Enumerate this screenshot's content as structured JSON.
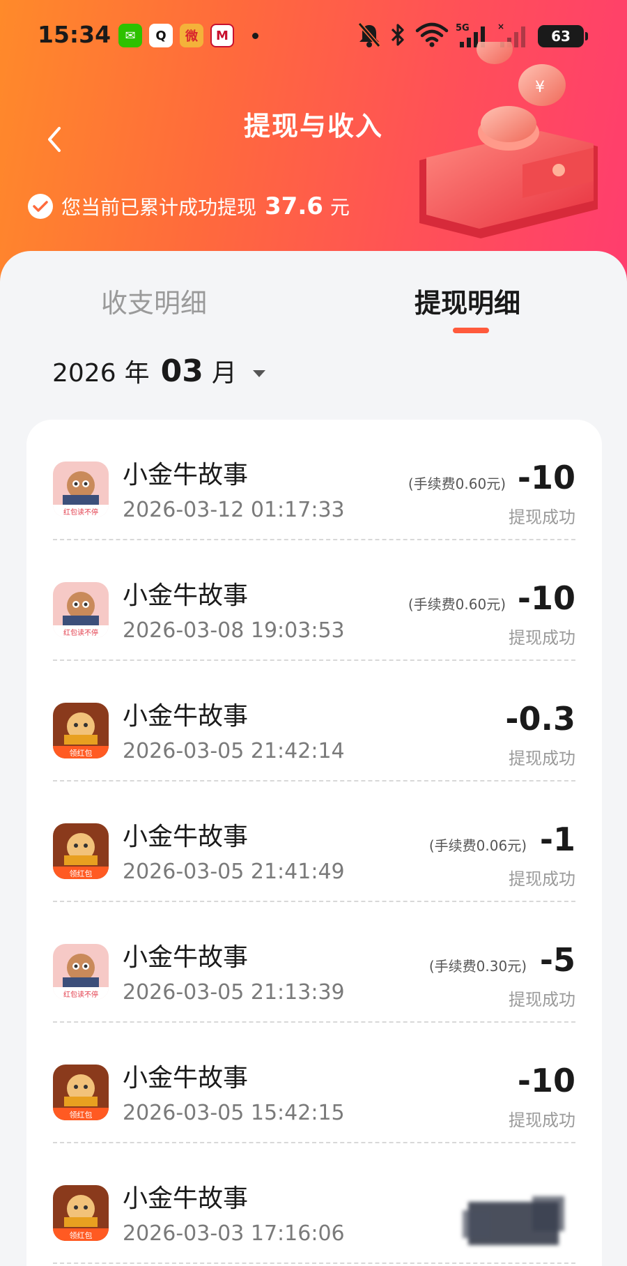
{
  "status_bar": {
    "time": "15:34",
    "battery": "63",
    "icons": [
      "wechat-icon",
      "qq-icon",
      "weibo-icon",
      "bank-icon",
      "mute-icon",
      "bluetooth-icon",
      "wifi-icon",
      "signal-5g-icon",
      "signal-icon",
      "battery-icon"
    ],
    "wechat_glyph": "✉",
    "qq_glyph": "Q",
    "weibo_glyph": "微",
    "bank_glyph": "M",
    "network_label": "5G"
  },
  "header": {
    "title": "提现与收入",
    "summary_text": "您当前已累计成功提现",
    "summary_amount": "37.6",
    "summary_unit": "元"
  },
  "tabs": [
    {
      "label": "收支明细",
      "active": false
    },
    {
      "label": "提现明细",
      "active": true
    }
  ],
  "month_picker": {
    "year": "2026",
    "year_unit": "年",
    "month": "03",
    "month_unit": "月"
  },
  "records": [
    {
      "app_name": "小金牛故事",
      "time": "2026-03-12 01:17:33",
      "fee": "(手续费0.60元)",
      "amount": "-10",
      "status": "提现成功",
      "icon_style": "pink",
      "icon_caption": "红包读不停"
    },
    {
      "app_name": "小金牛故事",
      "time": "2026-03-08 19:03:53",
      "fee": "(手续费0.60元)",
      "amount": "-10",
      "status": "提现成功",
      "icon_style": "pink",
      "icon_caption": "红包读不停"
    },
    {
      "app_name": "小金牛故事",
      "time": "2026-03-05 21:42:14",
      "fee": "",
      "amount": "-0.3",
      "status": "提现成功",
      "icon_style": "orange",
      "icon_caption": "领红包"
    },
    {
      "app_name": "小金牛故事",
      "time": "2026-03-05 21:41:49",
      "fee": "(手续费0.06元)",
      "amount": "-1",
      "status": "提现成功",
      "icon_style": "orange",
      "icon_caption": "领红包"
    },
    {
      "app_name": "小金牛故事",
      "time": "2026-03-05 21:13:39",
      "fee": "(手续费0.30元)",
      "amount": "-5",
      "status": "提现成功",
      "icon_style": "pink",
      "icon_caption": "红包读不停"
    },
    {
      "app_name": "小金牛故事",
      "time": "2026-03-05 15:42:15",
      "fee": "",
      "amount": "-10",
      "status": "提现成功",
      "icon_style": "orange",
      "icon_caption": "领红包"
    },
    {
      "app_name": "小金牛故事",
      "time": "2026-03-03 17:16:06",
      "fee": "",
      "amount": "",
      "status": "",
      "icon_style": "orange",
      "icon_caption": "领红包"
    }
  ],
  "colors": {
    "header_start": "#ff8a2a",
    "header_end": "#ff3d6e",
    "accent": "#ff5a3c"
  }
}
